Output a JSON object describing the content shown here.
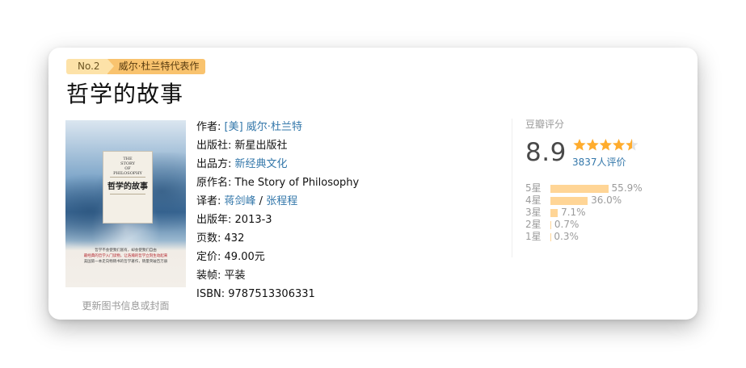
{
  "ribbon": {
    "rank": "No.2",
    "author_series": "威尔·杜兰特代表作"
  },
  "book": {
    "title": "哲学的故事",
    "cover": {
      "en_title_lines": [
        "THE",
        "STORY",
        "OF",
        "PHILOSOPHY"
      ],
      "zh_title": "哲学的故事",
      "blurb_lines": [
        "哲学不会使我们富有，却会使我们自由",
        "最经典的哲学入门读物，让浩瀚的哲学立刻生动起来",
        "美国第一本走向畅销书的哲学著作，销量突破百万册"
      ]
    },
    "update_link": "更新图书信息或封面"
  },
  "info": {
    "author_key": "作者:",
    "author_value": "[美] 威尔·杜兰特",
    "publisher_key": "出版社:",
    "publisher_value": "新星出版社",
    "producer_key": "出品方:",
    "producer_value": "新经典文化",
    "original_key": "原作名:",
    "original_value": "The Story of Philosophy",
    "translator_key": "译者:",
    "translator_1": "蒋剑峰",
    "translator_sep": " / ",
    "translator_2": "张程程",
    "year_key": "出版年:",
    "year_value": "2013-3",
    "pages_key": "页数:",
    "pages_value": "432",
    "price_key": "定价:",
    "price_value": "49.00元",
    "binding_key": "装帧:",
    "binding_value": "平装",
    "isbn_key": "ISBN:",
    "isbn_value": "9787513306331"
  },
  "rating": {
    "label": "豆瓣评分",
    "score": "8.9",
    "stars": 4.5,
    "votes": "3837人评价",
    "star_color": "#ffac2d",
    "bar_color": "#ffd596",
    "distribution": [
      {
        "label": "5星",
        "pct": "55.9%",
        "value": 55.9
      },
      {
        "label": "4星",
        "pct": "36.0%",
        "value": 36.0
      },
      {
        "label": "3星",
        "pct": "7.1%",
        "value": 7.1
      },
      {
        "label": "2星",
        "pct": "0.7%",
        "value": 0.7
      },
      {
        "label": "1星",
        "pct": "0.3%",
        "value": 0.3
      }
    ]
  }
}
